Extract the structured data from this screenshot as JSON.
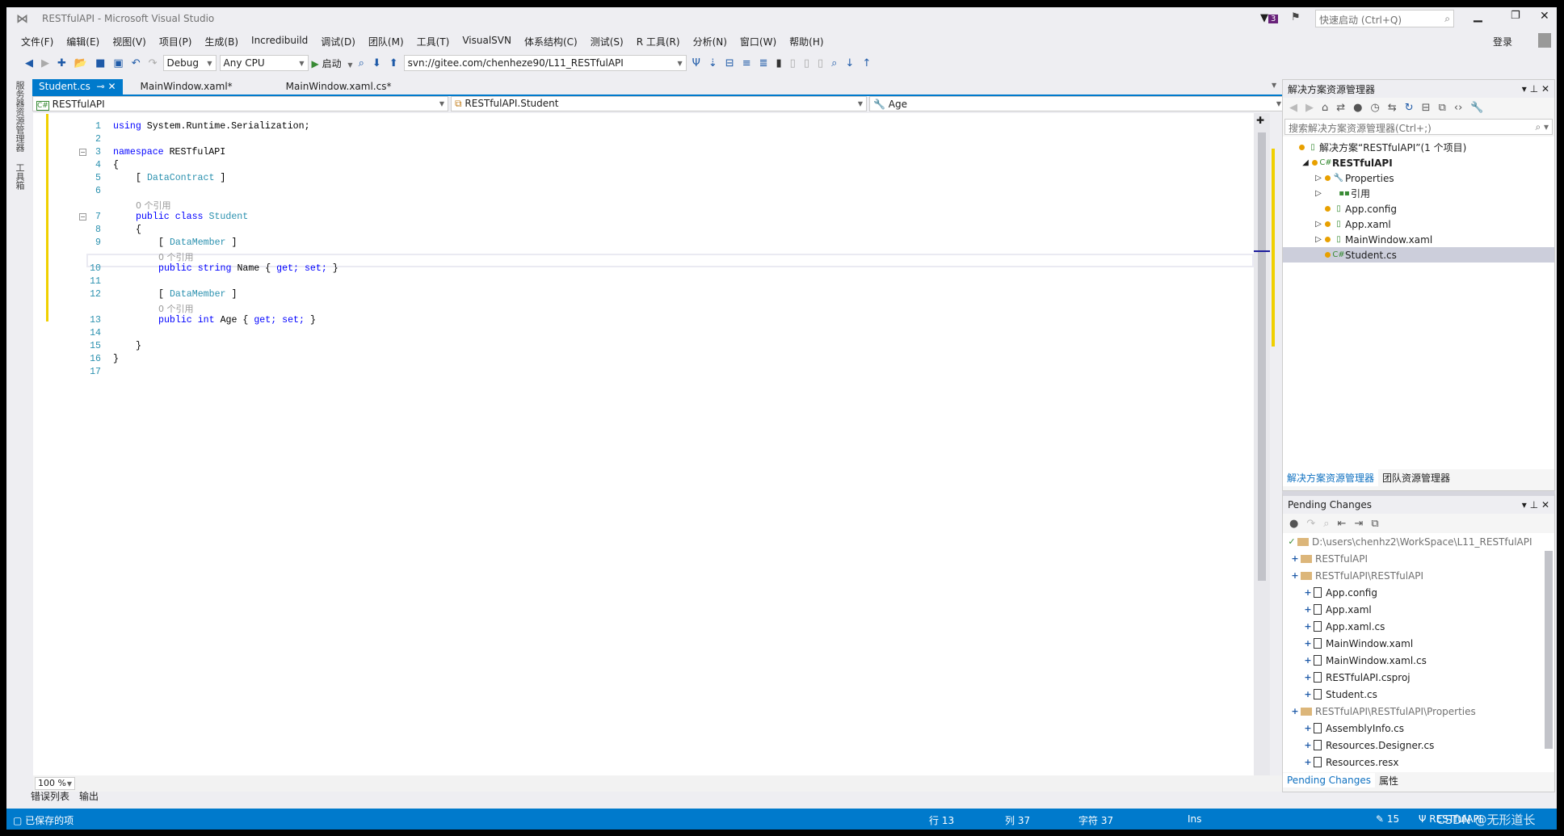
{
  "window": {
    "title": "RESTfulAPI - Microsoft Visual Studio",
    "notification_count": "3",
    "quick_launch_placeholder": "快速启动 (Ctrl+Q)",
    "sign_in": "登录"
  },
  "menu": [
    "文件(F)",
    "编辑(E)",
    "视图(V)",
    "项目(P)",
    "生成(B)",
    "Incredibuild",
    "调试(D)",
    "团队(M)",
    "工具(T)",
    "VisualSVN",
    "体系结构(C)",
    "测试(S)",
    "R 工具(R)",
    "分析(N)",
    "窗口(W)",
    "帮助(H)"
  ],
  "toolbar": {
    "configuration": "Debug",
    "platform": "Any CPU",
    "start": "启动",
    "svn_url": "svn://gitee.com/chenheze90/L11_RESTfulAPI"
  },
  "left_strip": [
    "服务器资源管理器",
    "工具箱"
  ],
  "tabs": [
    {
      "label": "Student.cs",
      "active": true
    },
    {
      "label": "MainWindow.xaml*"
    },
    {
      "label": "MainWindow.xaml.cs*"
    }
  ],
  "navbar": {
    "project": "RESTfulAPI",
    "type": "RESTfulAPI.Student",
    "member": "Age"
  },
  "editor": {
    "lines": [
      {
        "n": "1",
        "indent": 0,
        "tokens": [
          [
            "kw",
            "using"
          ],
          [
            "",
            "System.Runtime.Serialization;"
          ]
        ]
      },
      {
        "n": "2",
        "indent": 0,
        "tokens": []
      },
      {
        "n": "3",
        "indent": 0,
        "tokens": [
          [
            "kw",
            "namespace"
          ],
          [
            "",
            "RESTfulAPI"
          ]
        ]
      },
      {
        "n": "4",
        "indent": 0,
        "tokens": [
          [
            "",
            "{"
          ]
        ]
      },
      {
        "n": "5",
        "indent": 1,
        "tokens": [
          [
            "",
            "["
          ],
          [
            "ty",
            "DataContract"
          ],
          [
            "",
            "]"
          ]
        ]
      },
      {
        "n": "6",
        "indent": 0,
        "tokens": []
      },
      {
        "n": "",
        "indent": 1,
        "lens": "0 个引用"
      },
      {
        "n": "7",
        "indent": 1,
        "tokens": [
          [
            "kw",
            "public"
          ],
          [
            "kw",
            "class"
          ],
          [
            "ty",
            "Student"
          ]
        ]
      },
      {
        "n": "8",
        "indent": 1,
        "tokens": [
          [
            "",
            "{"
          ]
        ]
      },
      {
        "n": "9",
        "indent": 2,
        "tokens": [
          [
            "",
            "["
          ],
          [
            "ty",
            "DataMember"
          ],
          [
            "",
            "]"
          ]
        ]
      },
      {
        "n": "",
        "indent": 2,
        "lens": "0 个引用"
      },
      {
        "n": "10",
        "indent": 2,
        "tokens": [
          [
            "kw",
            "public"
          ],
          [
            "kw",
            "string"
          ],
          [
            "",
            "Name {"
          ],
          [
            "kw",
            "get;"
          ],
          [
            "kw",
            "set;"
          ],
          [
            "",
            "}"
          ]
        ]
      },
      {
        "n": "11",
        "indent": 0,
        "tokens": []
      },
      {
        "n": "12",
        "indent": 2,
        "tokens": [
          [
            "",
            "["
          ],
          [
            "ty",
            "DataMember"
          ],
          [
            "",
            "]"
          ]
        ]
      },
      {
        "n": "",
        "indent": 2,
        "lens": "0 个引用"
      },
      {
        "n": "13",
        "indent": 2,
        "tokens": [
          [
            "kw",
            "public"
          ],
          [
            "kw",
            "int"
          ],
          [
            "",
            "Age {"
          ],
          [
            "kw",
            "get;"
          ],
          [
            "kw",
            "set;"
          ],
          [
            "",
            "}"
          ]
        ]
      },
      {
        "n": "14",
        "indent": 0,
        "tokens": []
      },
      {
        "n": "15",
        "indent": 1,
        "tokens": [
          [
            "",
            "}"
          ]
        ]
      },
      {
        "n": "16",
        "indent": 0,
        "tokens": [
          [
            "",
            "}"
          ]
        ]
      },
      {
        "n": "17",
        "indent": 0,
        "tokens": []
      }
    ],
    "zoom": "100 %"
  },
  "solution_explorer": {
    "title": "解决方案资源管理器",
    "search_placeholder": "搜索解决方案资源管理器(Ctrl+;)",
    "items": [
      {
        "label": "解决方案“RESTfulAPI”(1 个项目)",
        "level": 0,
        "icon": "solution-icon"
      },
      {
        "label": "RESTfulAPI",
        "level": 1,
        "icon": "csharp-project-icon",
        "expanded": true,
        "bold": true
      },
      {
        "label": "Properties",
        "level": 2,
        "icon": "wrench-icon",
        "expander": true
      },
      {
        "label": "引用",
        "level": 2,
        "icon": "references-icon",
        "expander": true
      },
      {
        "label": "App.config",
        "level": 2,
        "icon": "config-file-icon"
      },
      {
        "label": "App.xaml",
        "level": 2,
        "icon": "xaml-file-icon",
        "expander": true
      },
      {
        "label": "MainWindow.xaml",
        "level": 2,
        "icon": "xaml-file-icon",
        "expander": true
      },
      {
        "label": "Student.cs",
        "level": 2,
        "icon": "csharp-file-icon",
        "selected": true
      }
    ],
    "tabs": [
      "解决方案资源管理器",
      "团队资源管理器"
    ]
  },
  "pending_changes": {
    "title": "Pending Changes",
    "items": [
      {
        "label": "D:\\users\\chenhz2\\WorkSpace\\L11_RESTfulAPI",
        "level": 0,
        "type": "root"
      },
      {
        "label": "RESTfulAPI",
        "level": 1,
        "type": "folder"
      },
      {
        "label": "RESTfulAPI\\RESTfulAPI",
        "level": 1,
        "type": "folder"
      },
      {
        "label": "App.config",
        "level": 2,
        "type": "file"
      },
      {
        "label": "App.xaml",
        "level": 2,
        "type": "file"
      },
      {
        "label": "App.xaml.cs",
        "level": 2,
        "type": "file"
      },
      {
        "label": "MainWindow.xaml",
        "level": 2,
        "type": "file"
      },
      {
        "label": "MainWindow.xaml.cs",
        "level": 2,
        "type": "file"
      },
      {
        "label": "RESTfulAPI.csproj",
        "level": 2,
        "type": "file"
      },
      {
        "label": "Student.cs",
        "level": 2,
        "type": "file"
      },
      {
        "label": "RESTfulAPI\\RESTfulAPI\\Properties",
        "level": 1,
        "type": "folder"
      },
      {
        "label": "AssemblyInfo.cs",
        "level": 2,
        "type": "file"
      },
      {
        "label": "Resources.Designer.cs",
        "level": 2,
        "type": "file"
      },
      {
        "label": "Resources.resx",
        "level": 2,
        "type": "file"
      }
    ],
    "tabs": [
      "Pending Changes",
      "属性"
    ]
  },
  "bottom_tabs": [
    "错误列表",
    "输出"
  ],
  "status": {
    "message": "已保存的项",
    "line": "行 13",
    "col": "列 37",
    "char": "字符 37",
    "mode": "Ins",
    "changes": "15",
    "branch": "RESTfulAPI",
    "watermark": "CSDN @无形道长"
  },
  "colors": {
    "accent": "#007acc",
    "change_marker": "#f0d000",
    "keyword": "#0000ff",
    "type": "#2b91af"
  }
}
